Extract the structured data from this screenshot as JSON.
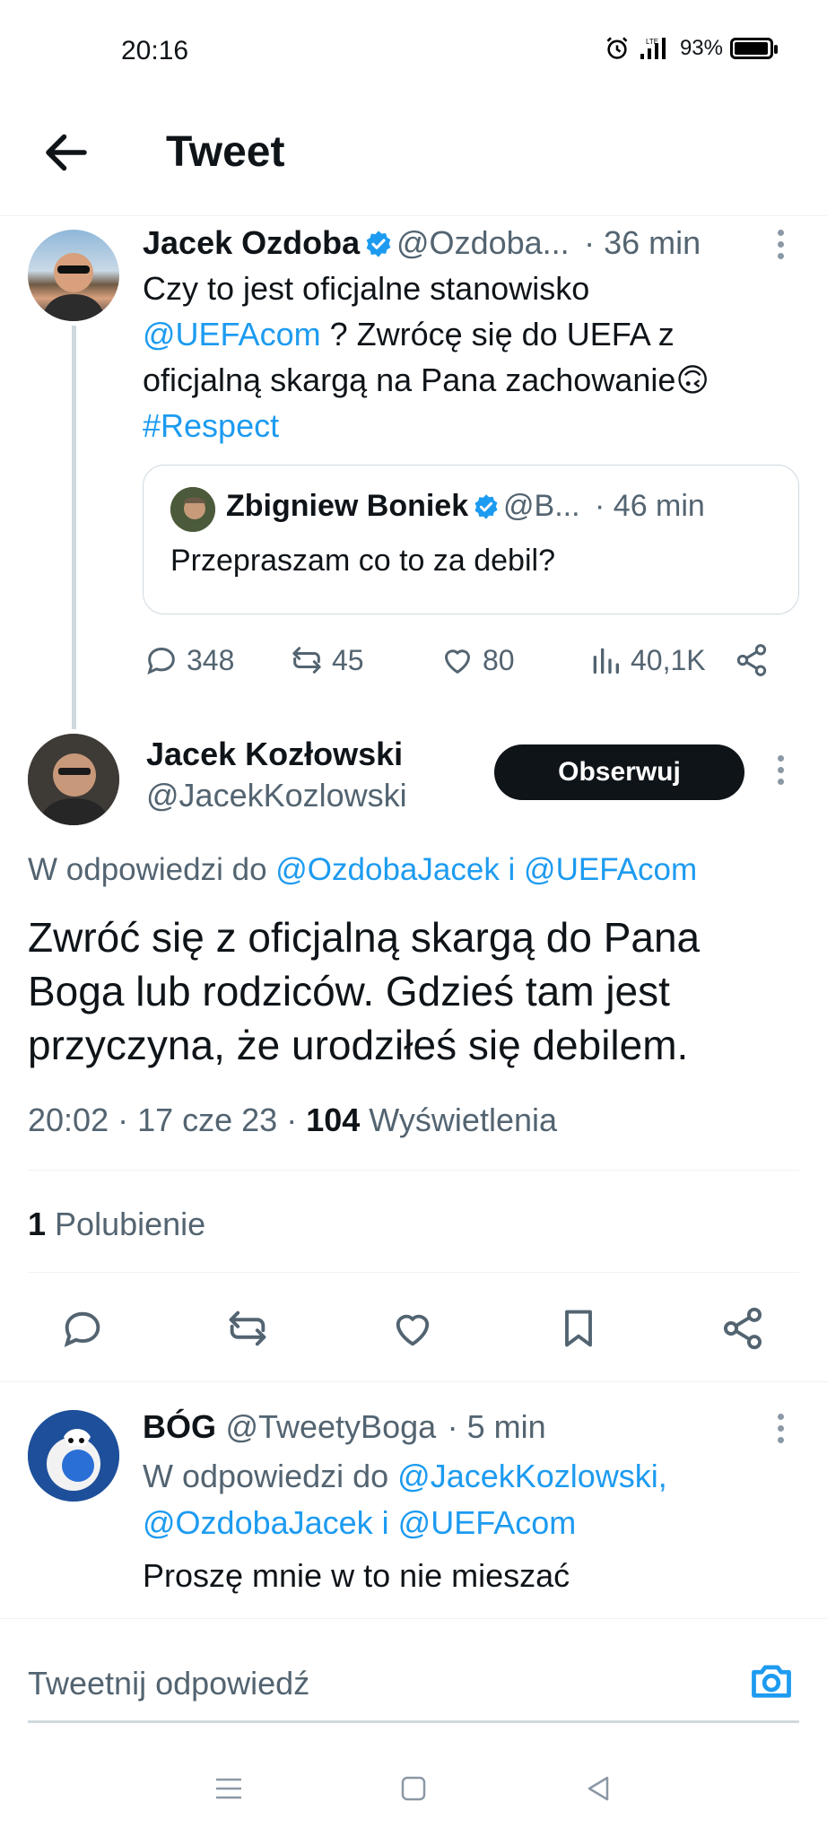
{
  "status_bar": {
    "time": "20:16",
    "battery": "93%",
    "network": "LTE"
  },
  "header": {
    "title": "Tweet"
  },
  "parent_tweet": {
    "name": "Jacek Ozdoba",
    "handle": "@Ozdoba...",
    "time": "· 36 min",
    "text_line1": "Czy to jest oficjalne stanowisko",
    "mention": "@UEFAcom",
    "text_line2_rest": " ? Zwrócę się do UEFA z",
    "text_line3": "oficjalną skargą na Pana zachowanie🙃",
    "hashtag": "#Respect",
    "quote": {
      "name": "Zbigniew Boniek",
      "handle": "@B...",
      "time": "· 46 min",
      "text": "Przepraszam co to za debil?"
    },
    "stats": {
      "replies": "348",
      "retweets": "45",
      "likes": "80",
      "views": "40,1K"
    }
  },
  "main_tweet": {
    "name": "Jacek Kozłowski",
    "handle": "@JacekKozlowski",
    "follow_label": "Obserwuj",
    "reply_to_prefix": "W odpowiedzi do",
    "reply_to_mentions": "@OzdobaJacek i @UEFAcom",
    "text": "Zwróć się z oficjalną skargą do Pana Boga lub rodziców. Gdzieś tam jest przyczyna, że urodziłeś się debilem.",
    "time": "20:02 · 17 cze 23 · ",
    "views_count": "104",
    "views_label": " Wyświetlenia",
    "likes_count": "1",
    "likes_label": " Polubienie"
  },
  "reply_tweet": {
    "name": "BÓG",
    "handle": "@TweetyBoga",
    "time": "· 5 min",
    "reply_prefix": "W odpowiedzi do",
    "reply_mentions_line1": "@JacekKozlowski,",
    "reply_mentions_line2": "@OzdobaJacek i @UEFAcom",
    "text": "Proszę mnie w to nie mieszać"
  },
  "composer": {
    "placeholder": "Tweetnij odpowiedź"
  },
  "colors": {
    "accent": "#1d9bf0",
    "text": "#0f1419",
    "secondary": "#536471",
    "divider": "#eff3f4"
  }
}
